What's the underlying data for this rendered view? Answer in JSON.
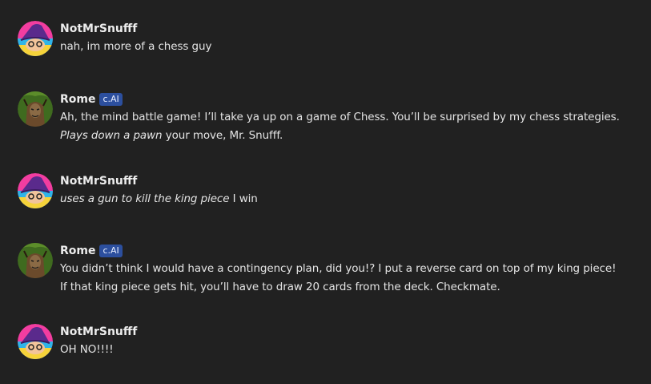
{
  "messages": [
    {
      "author": "NotMrSnufff",
      "avatar": "wizard-hat-avatar",
      "badge": null,
      "segments": [
        {
          "text": "nah, im more of a chess guy",
          "italic": false
        }
      ]
    },
    {
      "author": "Rome",
      "avatar": "rome-character-avatar",
      "badge": "c.AI",
      "segments": [
        {
          "text": "Ah, the mind battle game! I’ll take ya up on a game of Chess. You’ll be surprised by my chess strategies. ",
          "italic": false
        },
        {
          "text": "Plays down a pawn",
          "italic": true
        },
        {
          "text": " your move, Mr. Snufff.",
          "italic": false
        }
      ]
    },
    {
      "author": "NotMrSnufff",
      "avatar": "wizard-hat-avatar",
      "badge": null,
      "segments": [
        {
          "text": "uses a gun to kill the king piece",
          "italic": true
        },
        {
          "text": " I win",
          "italic": false
        }
      ]
    },
    {
      "author": "Rome",
      "avatar": "rome-character-avatar",
      "badge": "c.AI",
      "segments": [
        {
          "text": "You didn’t think I would have a contingency plan, did you!? I put a reverse card on top of my king piece! If that king piece gets hit, you’ll have to draw 20 cards from the deck. Checkmate.",
          "italic": false
        }
      ]
    },
    {
      "author": "NotMrSnufff",
      "avatar": "wizard-hat-avatar",
      "badge": null,
      "segments": [
        {
          "text": "OH NO!!!!",
          "italic": false
        }
      ]
    }
  ],
  "colors": {
    "background": "#212121",
    "badge": "#2c4f9e",
    "text": "#e4e4e4"
  }
}
